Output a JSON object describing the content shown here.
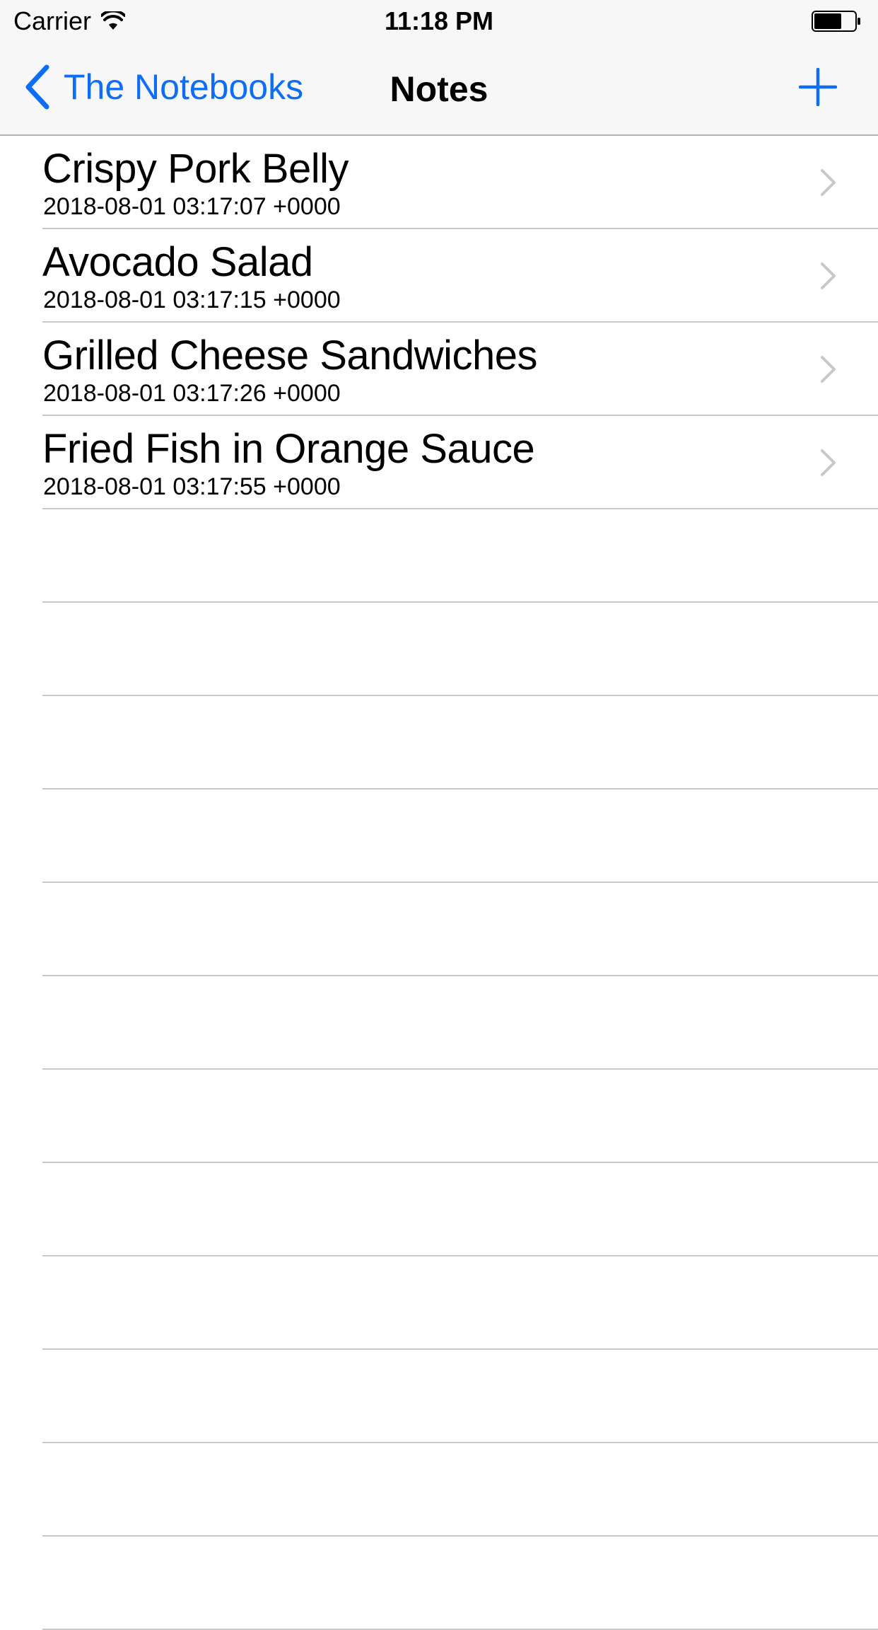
{
  "status_bar": {
    "carrier": "Carrier",
    "time": "11:18 PM",
    "wifi_icon": "wifi-icon",
    "battery_icon": "battery-icon"
  },
  "navbar": {
    "back_label": "The Notebooks",
    "back_icon": "chevron-left-icon",
    "title": "Notes",
    "add_icon": "plus-icon",
    "accent_color": "#0e6df5"
  },
  "notes": [
    {
      "title": "Crispy Pork Belly",
      "date": "2018-08-01 03:17:07 +0000"
    },
    {
      "title": "Avocado Salad",
      "date": "2018-08-01 03:17:15 +0000"
    },
    {
      "title": "Grilled Cheese Sandwiches",
      "date": "2018-08-01 03:17:26 +0000"
    },
    {
      "title": "Fried Fish in Orange Sauce",
      "date": "2018-08-01 03:17:55 +0000"
    }
  ]
}
